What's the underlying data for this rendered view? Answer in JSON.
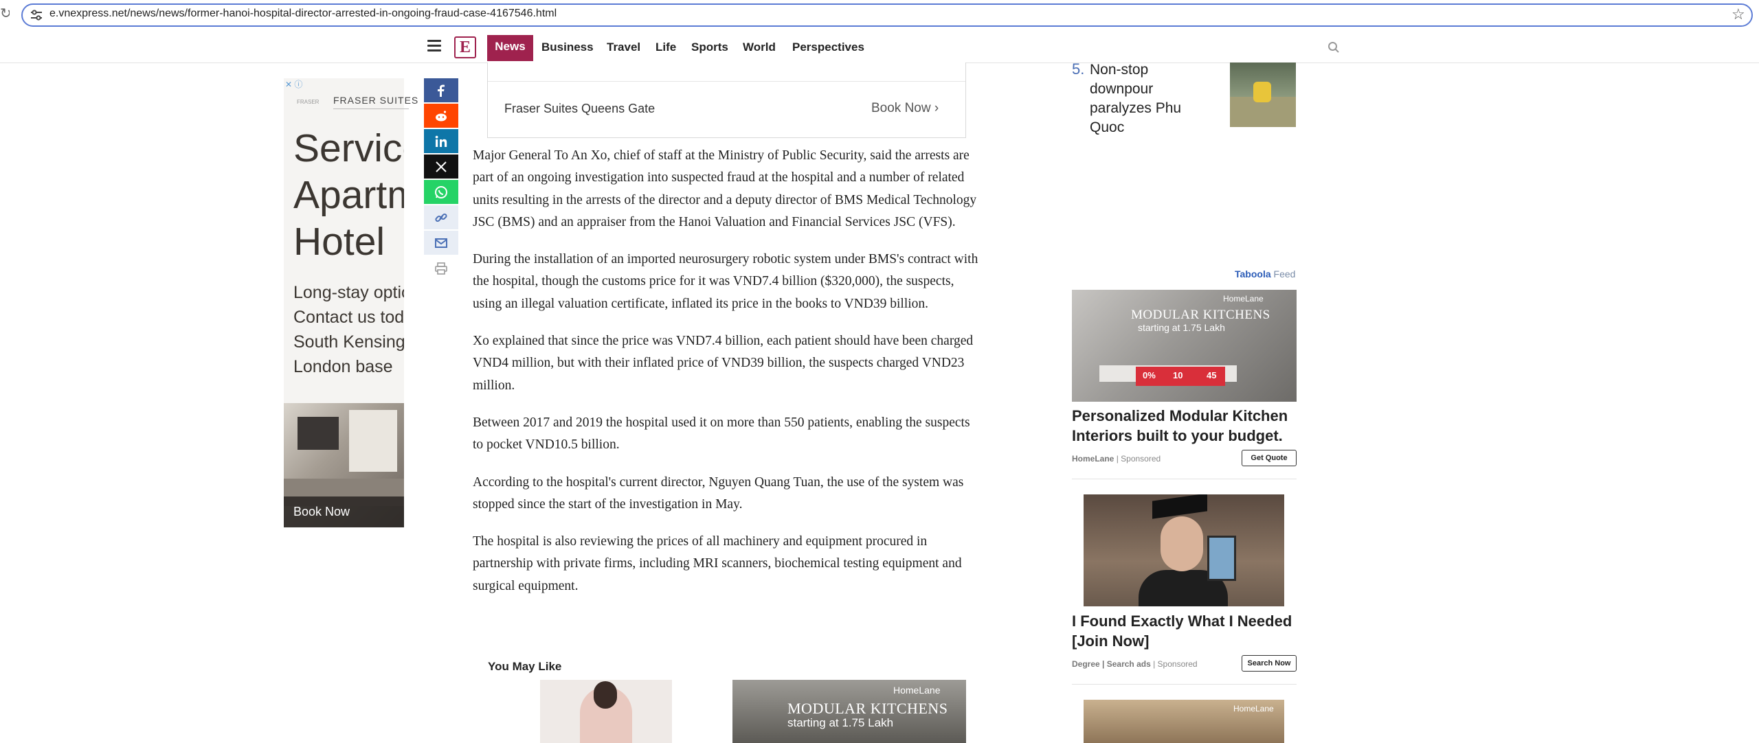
{
  "browser": {
    "url": "e.vnexpress.net/news/news/former-hanoi-hospital-director-arrested-in-ongoing-fraud-case-4167546.html"
  },
  "nav": {
    "items": [
      "News",
      "Business",
      "Travel",
      "Life",
      "Sports",
      "World",
      "Perspectives"
    ],
    "logo_glyph": "E",
    "active_color": "#9f224e"
  },
  "ad_left": {
    "brand": "FRASER SUITES",
    "logo_text": "FRASER",
    "headline": "Serviced\nApartment\nHotel",
    "body": "Long-stay option\nContact us today\nSouth Kensington\nLondon base",
    "cta": "Book Now"
  },
  "ad_top": {
    "name": "Fraser Suites Queens Gate",
    "cta": "Book Now"
  },
  "article": {
    "paragraphs": [
      "Major General To An Xo, chief of staff at the Ministry of Public Security, said the arrests are part of an ongoing investigation into suspected fraud at the hospital and a number of related units resulting in the arrests of the director and a deputy director of BMS Medical Technology JSC (BMS) and an appraiser from the Hanoi Valuation and Financial Services JSC (VFS).",
      "During the installation of an imported neurosurgery robotic system under BMS's contract with the hospital, though the customs price for it was VND7.4 billion ($320,000), the suspects, using an illegal valuation certificate, inflated its price in the books to VND39 billion.",
      "Xo explained that since the price was VND7.4 billion, each patient should have been charged VND4 million, but with their inflated price of VND39 billion, the suspects charged VND23 million.",
      "Between 2017 and 2019 the hospital used it on more than 550 patients, enabling the suspects to pocket VND10.5 billion.",
      "According to the hospital's current director, Nguyen Quang Tuan, the use of the system was stopped since the start of the investigation in May.",
      "The hospital is also reviewing the prices of all machinery and equipment procured in partnership with private firms, including MRI scanners, biochemical testing equipment and surgical equipment."
    ]
  },
  "you_may_like": {
    "title": "You May Like",
    "ad2_brand": "HomeLane",
    "ad2_line1": "MODULAR KITCHENS",
    "ad2_line2": "starting at 1.75 Lakh"
  },
  "trending": {
    "number": "5.",
    "title": "Non-stop\ndownpour\nparalyzes Phu\nQuoc"
  },
  "taboola": {
    "brand": "Taboola",
    "feed": "Feed"
  },
  "right_ads": [
    {
      "brand": "HomeLane",
      "img_line1": "MODULAR KITCHENS",
      "img_line2": "starting at 1.75 Lakh",
      "offers": [
        "0%",
        "10",
        "45"
      ],
      "title": "Personalized Modular Kitchen\nInteriors built to your budget.",
      "source": "HomeLane",
      "sponsored": "Sponsored",
      "cta": "Get Quote"
    },
    {
      "title": "I Found Exactly What I Needed\n[Join Now]",
      "source": "Degree | Search ads",
      "sponsored": "Sponsored",
      "cta": "Search Now"
    },
    {
      "brand": "HomeLane"
    }
  ]
}
